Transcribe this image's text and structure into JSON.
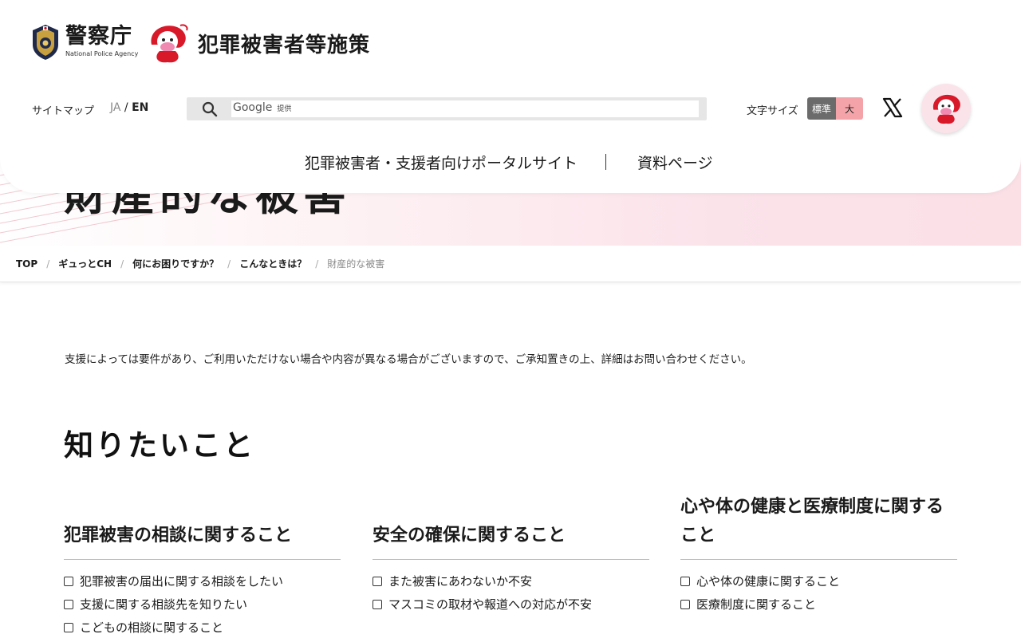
{
  "header": {
    "npa_name": "警察庁",
    "npa_name_en": "National Police Agency",
    "site_name": "犯罪被害者等施策",
    "sitemap_label": "サイトマップ",
    "lang_ja": "JA",
    "lang_sep": "/",
    "lang_en": "EN",
    "search": {
      "brand": "Google",
      "brand_suffix": "提供",
      "placeholder": ""
    },
    "font_size_label": "文字サイズ",
    "font_size_standard": "標準",
    "font_size_large": "大",
    "nav": [
      "犯罪被害者・支援者向けポータルサイト",
      "資料ページ"
    ]
  },
  "hero": {
    "title": "財産的な被害"
  },
  "breadcrumb": [
    "TOP",
    "ギュっとCH",
    "何にお困りですか？",
    "こんなときは？",
    "財産的な被害"
  ],
  "breadcrumb_sep": "/",
  "notice": "支援によっては要件があり、ご利用いただけない場合や内容が異なる場合がございますので、ご承知置きの上、詳細はお問い合わせください。",
  "section_title": "知りたいこと",
  "columns": [
    {
      "heading": "犯罪被害の相談に関すること",
      "items": [
        "犯罪被害の届出に関する相談をしたい",
        "支援に関する相談先を知りたい",
        "こどもの相談に関すること"
      ]
    },
    {
      "heading": "安全の確保に関すること",
      "items": [
        "また被害にあわないか不安",
        "マスコミの取材や報道への対応が不安"
      ]
    },
    {
      "heading": "心や体の健康と医療制度に関すること",
      "items": [
        "心や体の健康に関すること",
        "医療制度に関すること"
      ]
    }
  ],
  "colors": {
    "accent_pink": "#f4a4a8",
    "divider": "#e8a7ac",
    "hero_pink": "#fbe3ea",
    "fs_standard_bg": "#6b6b6b"
  },
  "icons": [
    "npa-emblem-icon",
    "mascot-icon",
    "search-icon",
    "x-logo-icon",
    "checkbox-icon"
  ]
}
